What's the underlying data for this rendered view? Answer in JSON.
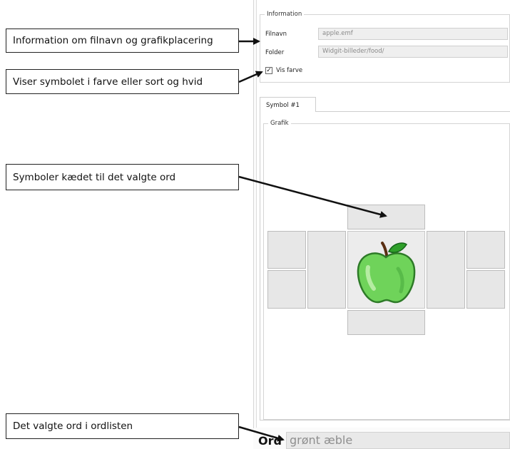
{
  "callouts": {
    "filename_info": "Information om filnavn og grafikplacering",
    "color_toggle": "Viser symbolet i farve eller sort og hvid",
    "linked_symbols": "Symboler kædet til det valgte ord",
    "selected_word": "Det valgte ord i ordlisten"
  },
  "information": {
    "legend": "Information",
    "filename_label": "Filnavn",
    "filename_value": "apple.emf",
    "folder_label": "Folder",
    "folder_value": "Widgit-billeder/food/",
    "color_checkbox_label": "Vis farve",
    "color_checked": true
  },
  "tabs": [
    {
      "label": "Symbol #1"
    }
  ],
  "graphic": {
    "legend": "Grafik",
    "center_icon": "apple-icon"
  },
  "word": {
    "label": "Ord",
    "value": "grønt æble"
  },
  "colors": {
    "apple_green": "#6fd35a",
    "callout_border": "#222222"
  }
}
